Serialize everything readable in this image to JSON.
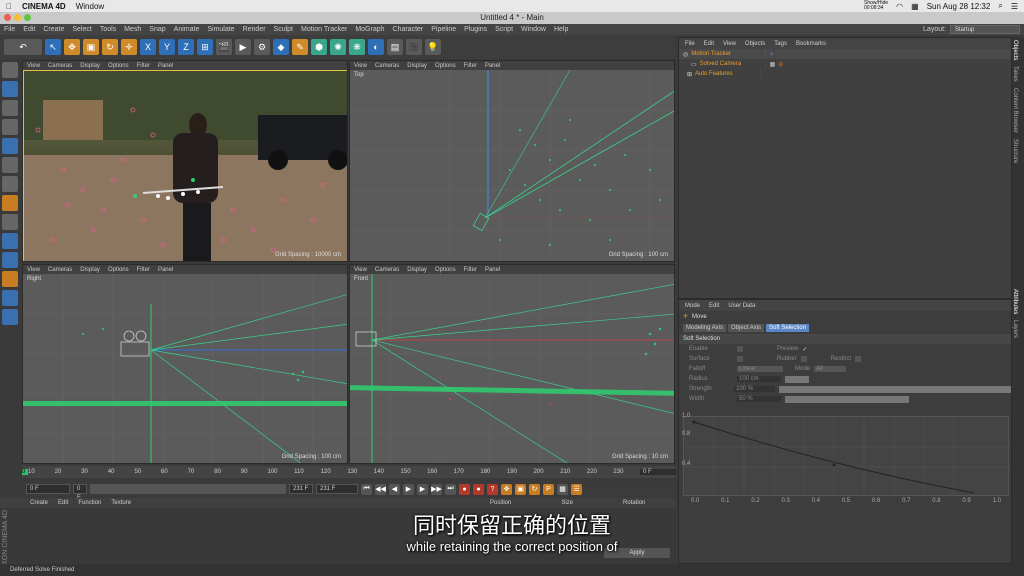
{
  "mac": {
    "apple": "",
    "app": "CINEMA 4D",
    "window_menu": "Window",
    "recording_label": "Show/Hide\n00:08:34",
    "date_time": "Sun Aug 28  12:32"
  },
  "window": {
    "title": "Untitled 4 * - Main"
  },
  "menus": [
    "File",
    "Edit",
    "Create",
    "Select",
    "Tools",
    "Mesh",
    "Snap",
    "Animate",
    "Simulate",
    "Render",
    "Sculpt",
    "Motion Tracker",
    "MoGraph",
    "Character",
    "Pipeline",
    "Plugins",
    "Script",
    "Window",
    "Help"
  ],
  "layout": {
    "label": "Layout:",
    "value": "Startup"
  },
  "viewports": [
    {
      "menu": [
        "View",
        "Cameras",
        "Display",
        "Options",
        "Filter",
        "Panel"
      ],
      "label": "",
      "grid": "Grid Spacing : 10000 cm"
    },
    {
      "menu": [
        "View",
        "Cameras",
        "Display",
        "Options",
        "Filter",
        "Panel"
      ],
      "label": "Top",
      "grid": "Grid Spacing : 100 cm"
    },
    {
      "menu": [
        "View",
        "Cameras",
        "Display",
        "Options",
        "Filter",
        "Panel"
      ],
      "label": "Right",
      "grid": "Grid Spacing : 100 cm"
    },
    {
      "menu": [
        "View",
        "Cameras",
        "Display",
        "Options",
        "Filter",
        "Panel"
      ],
      "label": "Front",
      "grid": "Grid Spacing : 10 cm"
    }
  ],
  "timeline": {
    "ticks": [
      "0",
      "10",
      "20",
      "30",
      "40",
      "50",
      "60",
      "70",
      "80",
      "90",
      "100",
      "110",
      "120",
      "130",
      "140",
      "150",
      "160",
      "170",
      "180",
      "190",
      "200",
      "210",
      "220",
      "230"
    ],
    "current": "0 F"
  },
  "playbar": {
    "start": "0 F",
    "start2": "0 F",
    "end": "231 F",
    "end2": "231 F"
  },
  "material_menu": [
    "Create",
    "Edit",
    "Function",
    "Texture"
  ],
  "coord_headers": [
    "Position",
    "Size",
    "Rotation"
  ],
  "apply_label": "Apply",
  "maxon": "MAXON CINEMA 4D",
  "status": "Deferred Solve Finished",
  "objects": {
    "menu": [
      "File",
      "Edit",
      "View",
      "Objects",
      "Tags",
      "Bookmarks"
    ],
    "items": [
      "Motion Tracker",
      "Solved Camera",
      "Auto Features"
    ]
  },
  "attributes": {
    "menu": [
      "Mode",
      "Edit",
      "User Data"
    ],
    "tool": "Move",
    "tabs": [
      "Modeling Axis",
      "Object Axis",
      "Soft Selection"
    ],
    "section": "Soft Selection",
    "rows": {
      "enable": "Enable",
      "preview": "Preview",
      "surface": "Surface",
      "rubber": "Rubber",
      "restrict": "Restrict",
      "falloff": "Falloff",
      "falloff_val": "Linear",
      "mode": "Mode",
      "mode_val": "All",
      "radius": "Radius",
      "radius_val": "100 cm",
      "strength": "Strength",
      "strength_val": "100 %",
      "width": "Width",
      "width_val": "50 %"
    },
    "graph_y": [
      "1.0",
      "0.8",
      "0.4"
    ],
    "graph_x": [
      "0.0",
      "0.1",
      "0.2",
      "0.3",
      "0.4",
      "0.5",
      "0.6",
      "0.7",
      "0.8",
      "0.9",
      "1.0"
    ]
  },
  "right_tabs": [
    "Objects",
    "Takes",
    "Content Browser",
    "Structure",
    "Attributes",
    "Layers"
  ],
  "subtitles": {
    "cn": "同时保留正确的位置",
    "en": "while retaining the correct position of"
  }
}
